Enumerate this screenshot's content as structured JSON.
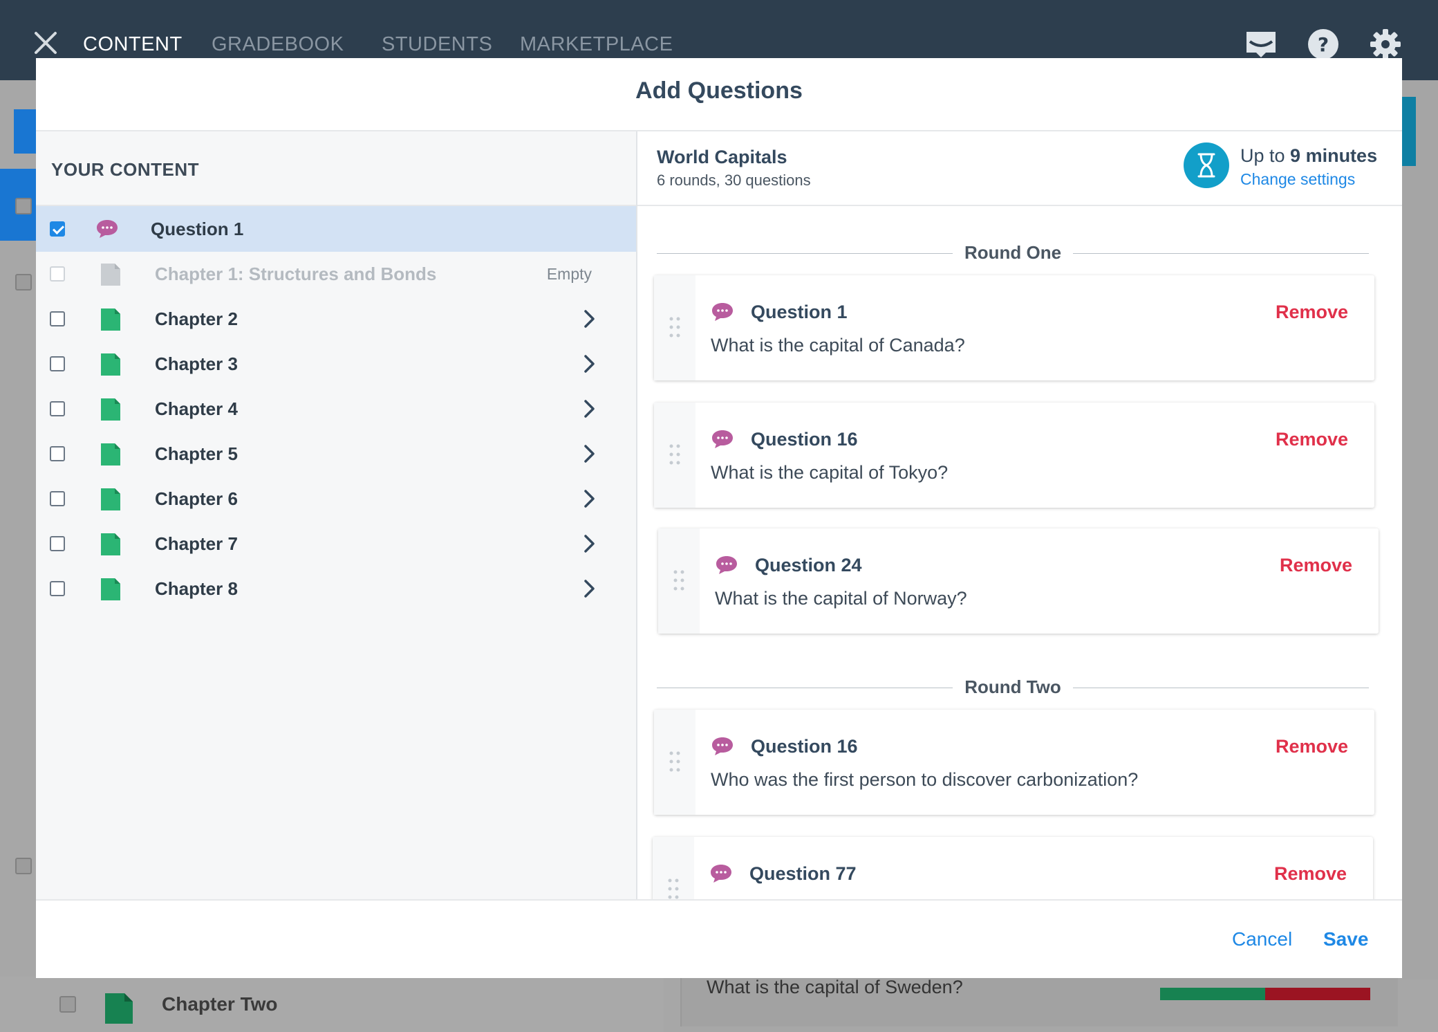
{
  "nav": {
    "items": [
      "CONTENT",
      "GRADEBOOK",
      "STUDENTS",
      "MARKETPLACE"
    ],
    "active": "CONTENT"
  },
  "background": {
    "chapter_label": "Chapter Two",
    "question_text": "What is the capital of Sweden?",
    "bar_colors": {
      "correct": "#178251",
      "incorrect": "#9b1422"
    }
  },
  "modal": {
    "title": "Add Questions",
    "left": {
      "header": "YOUR CONTENT",
      "rows": [
        {
          "label": "Question 1",
          "type": "question",
          "checked": true
        },
        {
          "label": "Chapter 1: Structures and Bonds",
          "type": "chapter",
          "disabled": true,
          "tag": "Empty"
        },
        {
          "label": "Chapter 2",
          "type": "chapter"
        },
        {
          "label": "Chapter 3",
          "type": "chapter"
        },
        {
          "label": "Chapter 4",
          "type": "chapter"
        },
        {
          "label": "Chapter 5",
          "type": "chapter"
        },
        {
          "label": "Chapter 6",
          "type": "chapter"
        },
        {
          "label": "Chapter 7",
          "type": "chapter"
        },
        {
          "label": "Chapter 8",
          "type": "chapter"
        }
      ]
    },
    "right": {
      "quiz_title": "World Capitals",
      "quiz_subtitle": "6 rounds, 30 questions",
      "timer_prefix": "Up to ",
      "timer_value": "9 minutes",
      "change_settings": "Change settings",
      "remove_label": "Remove",
      "rounds": [
        {
          "title": "Round One",
          "questions": [
            {
              "title": "Question 1",
              "text": "What is the capital of Canada?"
            },
            {
              "title": "Question 16",
              "text": "What is the capital of Tokyo?"
            },
            {
              "title": "Question 24",
              "text": "What is the capital of Norway?"
            }
          ]
        },
        {
          "title": "Round Two",
          "questions": [
            {
              "title": "Question 16",
              "text": "Who was the first person to discover carbonization?"
            },
            {
              "title": "Question 77",
              "text": ""
            }
          ]
        }
      ]
    },
    "footer": {
      "cancel": "Cancel",
      "save": "Save"
    }
  },
  "colors": {
    "nav_bg": "#2d3e4e",
    "accent": "#1e88e5",
    "remove": "#e0304a",
    "chapter_icon": "#2bb574",
    "question_icon": "#b85c9e",
    "timer": "#129fc9"
  },
  "icons": {
    "close": "close-icon",
    "inbox": "inbox-icon",
    "help": "help-icon",
    "settings": "gear-icon",
    "question": "speech-bubble-icon",
    "chapter": "document-icon",
    "timer": "hourglass-icon",
    "drag": "drag-handle-icon",
    "expand": "chevron-right-icon"
  }
}
